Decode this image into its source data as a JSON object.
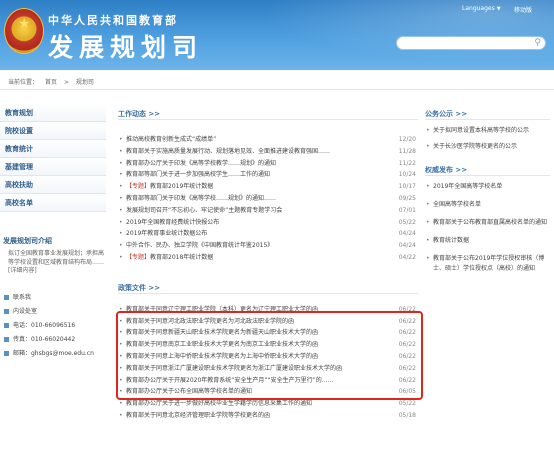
{
  "header": {
    "ministry_name": "中华人民共和国教育部",
    "department": "发展规划司",
    "languages_label": "Languages",
    "mobile_label": "移动版",
    "search_placeholder": ""
  },
  "breadcrumb": [
    "当前位置：",
    "首页",
    ">",
    "规划司"
  ],
  "leftnav": {
    "items": [
      "教育规划",
      "院校设置",
      "教育统计",
      "基建管理",
      "高校扶助",
      "高校名单"
    ],
    "intro_title": "发展规划司介绍",
    "intro_text": "拟订全国教育事业发展规划；承担高等学校设置和区域教育结构布局……[详细内容]",
    "contacts": [
      "联系我",
      "内设处室",
      "电话：010-66096516",
      "传真：010-66020442",
      "邮箱：ghsbgs@moe.edu.cn"
    ]
  },
  "work_news": {
    "title": "工作动态 >>",
    "items": [
      {
        "tag": "",
        "text": "推动高校教育创新生成式“成绩单”",
        "date": "12/20"
      },
      {
        "tag": "",
        "text": "教育部关于实施高质量发展行动、规划落地见效、全面推进建设教育强国……",
        "date": "11/28"
      },
      {
        "tag": "",
        "text": "教育部办公厅关于印发《高等学校教学……规划》的通知",
        "date": "11/22"
      },
      {
        "tag": "",
        "text": "教育部等部门关于进一步加强高校学生……工作的通知",
        "date": "10/24"
      },
      {
        "tag": "【专题】",
        "text": "教育部2019年统计数据",
        "date": "10/17"
      },
      {
        "tag": "",
        "text": "教育部等部门关于印发《高等学校……规划》的通知……",
        "date": "09/25"
      },
      {
        "tag": "",
        "text": "发展规划司召开“不忘初心、牢记使命”主题教育专题学习会",
        "date": "07/01"
      },
      {
        "tag": "",
        "text": "2019年全国教育经费统计快报公布",
        "date": "05/22"
      },
      {
        "tag": "",
        "text": "2019年教育事业统计数据公布",
        "date": "04/24"
      },
      {
        "tag": "",
        "text": "中外合作、民办、独立学院《中国教育统计年鉴2015》",
        "date": "04/24"
      },
      {
        "tag": "【专题】",
        "text": "教育部2018年统计数据",
        "date": "04/22"
      }
    ]
  },
  "policy_docs": {
    "title": "政策文件 >>",
    "items": [
      {
        "text": "教育部关于同意辽宁理工职业学院（本科）更名为辽宁理工职业大学的函",
        "date": "06/22"
      },
      {
        "text": "教育部关于同意河北政法职业学院更名为河北政法职业学院的函",
        "date": "06/22"
      },
      {
        "text": "教育部关于同意新疆天山职业技术学院更名为新疆天山职业技术大学的函",
        "date": "06/22"
      },
      {
        "text": "教育部关于同意南京工业职业技术大学更名为南京工业职业技术大学的函",
        "date": "06/22"
      },
      {
        "text": "教育部关于同意上海中侨职业技术学院更名为上海中侨职业技术大学的函",
        "date": "06/22"
      },
      {
        "text": "教育部关于同意浙江广厦建设职业技术学院更名为浙江广厦建设职业技术大学的函",
        "date": "06/22"
      },
      {
        "text": "教育部办公厅关于开展2020年教育系统“安全生产月”“安全生产万里行”的……",
        "date": "06/22"
      },
      {
        "text": "教育部办公厅关于公布全国高等学校名单的通知",
        "date": "06/05"
      },
      {
        "text": "教育部办公厅关于进一步做好高校毕业生学籍学历信息采集工作的通知",
        "date": "05/22"
      },
      {
        "text": "教育部关于同意北京经济管理职业学院等学校更名的函",
        "date": "05/18"
      }
    ]
  },
  "notices": {
    "title": "公务公示 >>",
    "items": [
      "关于拟同意设置本科高等学校的公示",
      "关于长沙医学院等校更名的公示"
    ]
  },
  "authority": {
    "title": "权威发布 >>",
    "items": [
      "2019年全国高等学校名单",
      "全国高等学校名单",
      "教育部关于公布教育部直属高校名单的通知",
      "教育统计数据",
      "教育部关于公布2019年学位授权审核（博士、硕士）学位授权点（高校）的通知"
    ]
  }
}
